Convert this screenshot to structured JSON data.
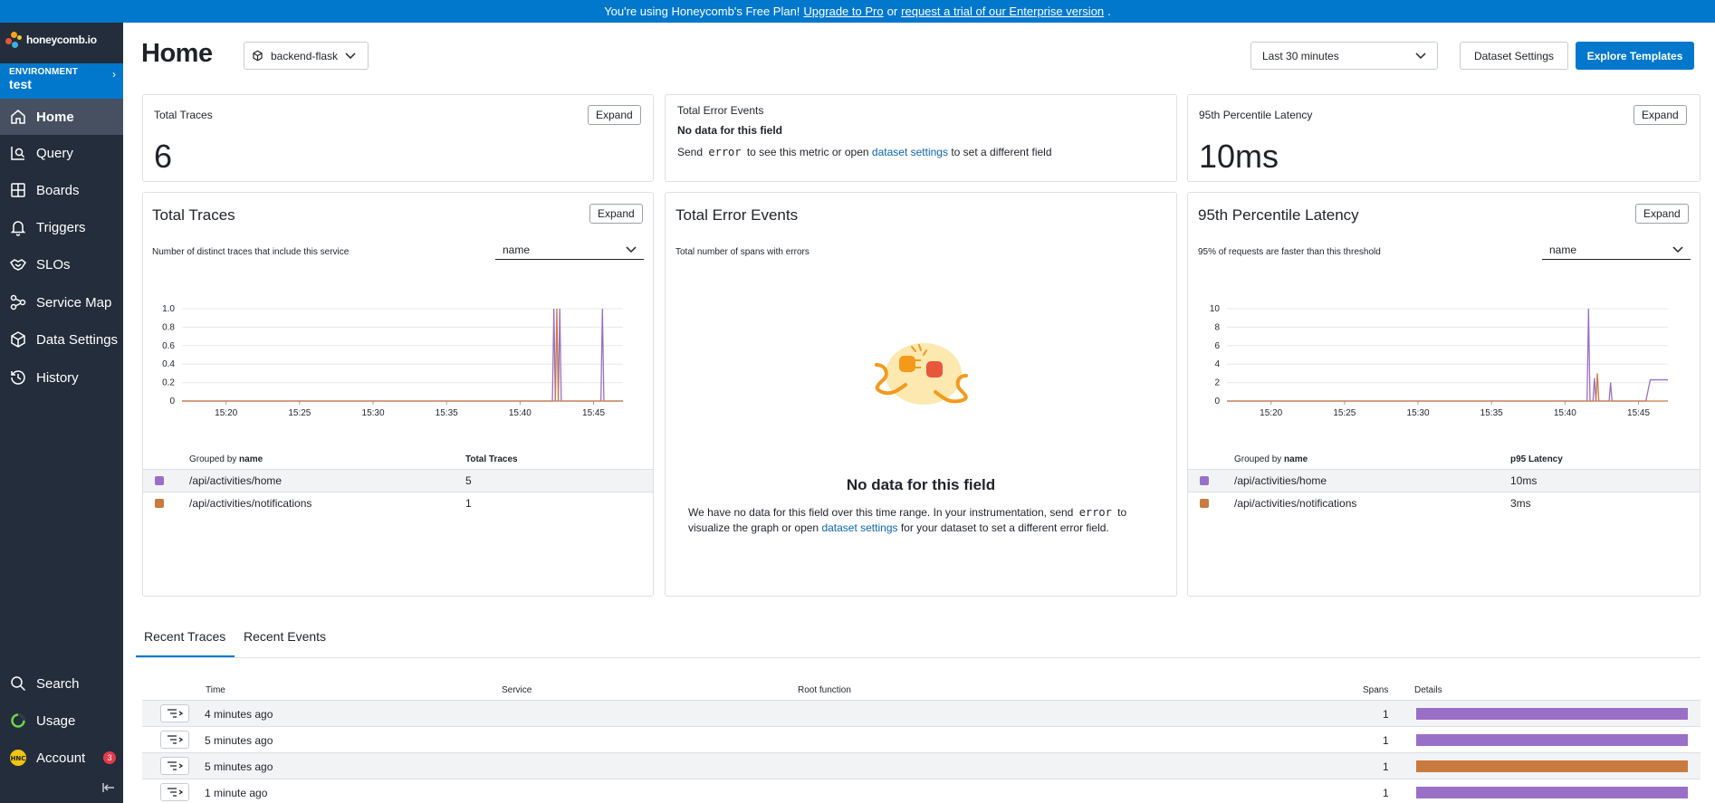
{
  "banner": {
    "prefix": "You're using Honeycomb's Free Plan!",
    "link1": "Upgrade to Pro",
    "mid": "or",
    "link2": "request a trial of our Enterprise version",
    "suffix": "."
  },
  "sidebar": {
    "logo_text": "honeycomb.io",
    "environment_label": "ENVIRONMENT",
    "environment_value": "test",
    "items": [
      {
        "label": "Home",
        "icon": "home-icon"
      },
      {
        "label": "Query",
        "icon": "query-icon"
      },
      {
        "label": "Boards",
        "icon": "boards-icon"
      },
      {
        "label": "Triggers",
        "icon": "bell-icon"
      },
      {
        "label": "SLOs",
        "icon": "handshake-icon"
      },
      {
        "label": "Service Map",
        "icon": "service-map-icon"
      },
      {
        "label": "Data Settings",
        "icon": "cube-icon"
      },
      {
        "label": "History",
        "icon": "history-icon"
      }
    ],
    "bottom_items": [
      {
        "label": "Search",
        "icon": "search-icon"
      },
      {
        "label": "Usage",
        "icon": "usage-icon"
      },
      {
        "label": "Account",
        "icon": "account-avatar",
        "avatar_text": "HNC",
        "badge": "3"
      }
    ]
  },
  "header": {
    "title": "Home",
    "dataset": "backend-flask",
    "time_range": "Last 30 minutes",
    "dataset_settings": "Dataset Settings",
    "explore_templates": "Explore Templates"
  },
  "summary": {
    "total_traces": {
      "title": "Total Traces",
      "value": "6",
      "expand": "Expand"
    },
    "error_events": {
      "title": "Total Error Events",
      "nodata": "No data for this field",
      "send": "Send",
      "field": "error",
      "msg_mid": "to see this metric or open",
      "link": "dataset settings",
      "msg_end": "to set a different field"
    },
    "latency": {
      "title": "95th Percentile Latency",
      "value": "10ms",
      "expand": "Expand"
    }
  },
  "panels": {
    "traces": {
      "title": "Total Traces",
      "expand": "Expand",
      "subtitle": "Number of distinct traces that include this service",
      "group_select": "name",
      "group_head_prefix": "Grouped by",
      "group_head_field": "name",
      "value_head": "Total Traces",
      "rows": [
        {
          "name": "/api/activities/home",
          "value": "5",
          "color": "#9a6fc7"
        },
        {
          "name": "/api/activities/notifications",
          "value": "1",
          "color": "#c97a3e"
        }
      ]
    },
    "errors": {
      "title": "Total Error Events",
      "subtitle": "Total number of spans with errors",
      "nodata_title": "No data for this field",
      "line1": "We have no data for this field over this time range. In your instrumentation, send",
      "field": "error",
      "line1_end": "to",
      "line2a": "visualize the graph or open",
      "link": "dataset settings",
      "line2b": "for your dataset to set a different error field."
    },
    "latency": {
      "title": "95th Percentile Latency",
      "expand": "Expand",
      "subtitle": "95% of requests are faster than this threshold",
      "group_select": "name",
      "group_head_prefix": "Grouped by",
      "group_head_field": "name",
      "value_head": "p95 Latency",
      "rows": [
        {
          "name": "/api/activities/home",
          "value": "10ms",
          "color": "#9a6fc7"
        },
        {
          "name": "/api/activities/notifications",
          "value": "3ms",
          "color": "#c97a3e"
        }
      ]
    }
  },
  "chart_data": [
    {
      "type": "line",
      "title": "Total Traces",
      "x_ticks": [
        "15:20",
        "15:25",
        "15:30",
        "15:35",
        "15:40",
        "15:45"
      ],
      "y_ticks": [
        "0",
        "0.2",
        "0.4",
        "0.6",
        "0.8",
        "1.0"
      ],
      "ylim": [
        0,
        1
      ],
      "xlim": [
        "15:17",
        "15:47"
      ],
      "series": [
        {
          "color": "#9a6fc7",
          "x": [
            "15:17",
            "15:42.2",
            "15:42.3",
            "15:42.4",
            "15:42.6",
            "15:42.7",
            "15:42.8",
            "15:45.5",
            "15:45.6",
            "15:45.7",
            "15:47"
          ],
          "y": [
            0,
            0,
            1,
            0,
            0,
            1,
            0,
            0,
            1,
            0,
            0
          ]
        },
        {
          "color": "#c97a3e",
          "x": [
            "15:17",
            "15:42.4",
            "15:42.5",
            "15:42.6",
            "15:47"
          ],
          "y": [
            0,
            0,
            1,
            0,
            0
          ]
        }
      ]
    },
    {
      "type": "line",
      "title": "95th Percentile Latency",
      "x_ticks": [
        "15:20",
        "15:25",
        "15:30",
        "15:35",
        "15:40",
        "15:45"
      ],
      "y_ticks": [
        "0",
        "2",
        "4",
        "6",
        "8",
        "10"
      ],
      "ylim": [
        0,
        10
      ],
      "xlim": [
        "15:17",
        "15:47"
      ],
      "series": [
        {
          "color": "#9a6fc7",
          "x": [
            "15:17",
            "15:41.5",
            "15:41.6",
            "15:41.7",
            "15:41.9",
            "15:42.0",
            "15:42.1",
            "15:43.0",
            "15:43.1",
            "15:43.2",
            "15:45.5",
            "15:45.8",
            "15:47"
          ],
          "y": [
            0,
            0,
            10,
            0,
            0,
            2.5,
            0,
            0,
            2,
            0,
            0,
            2.3,
            2.3
          ]
        },
        {
          "color": "#c97a3e",
          "x": [
            "15:17",
            "15:42.1",
            "15:42.2",
            "15:42.3",
            "15:47"
          ],
          "y": [
            0,
            0,
            3,
            0,
            0
          ]
        }
      ]
    }
  ],
  "recent": {
    "tabs": [
      "Recent Traces",
      "Recent Events"
    ],
    "headers": {
      "time": "Time",
      "service": "Service",
      "root": "Root function",
      "spans": "Spans",
      "details": "Details"
    },
    "rows": [
      {
        "time": "4 minutes ago",
        "spans": "1",
        "color": "#9a6fc7"
      },
      {
        "time": "5 minutes ago",
        "spans": "1",
        "color": "#9a6fc7"
      },
      {
        "time": "5 minutes ago",
        "spans": "1",
        "color": "#c97a3e"
      },
      {
        "time": "1 minute ago",
        "spans": "1",
        "color": "#9a6fc7"
      }
    ]
  }
}
